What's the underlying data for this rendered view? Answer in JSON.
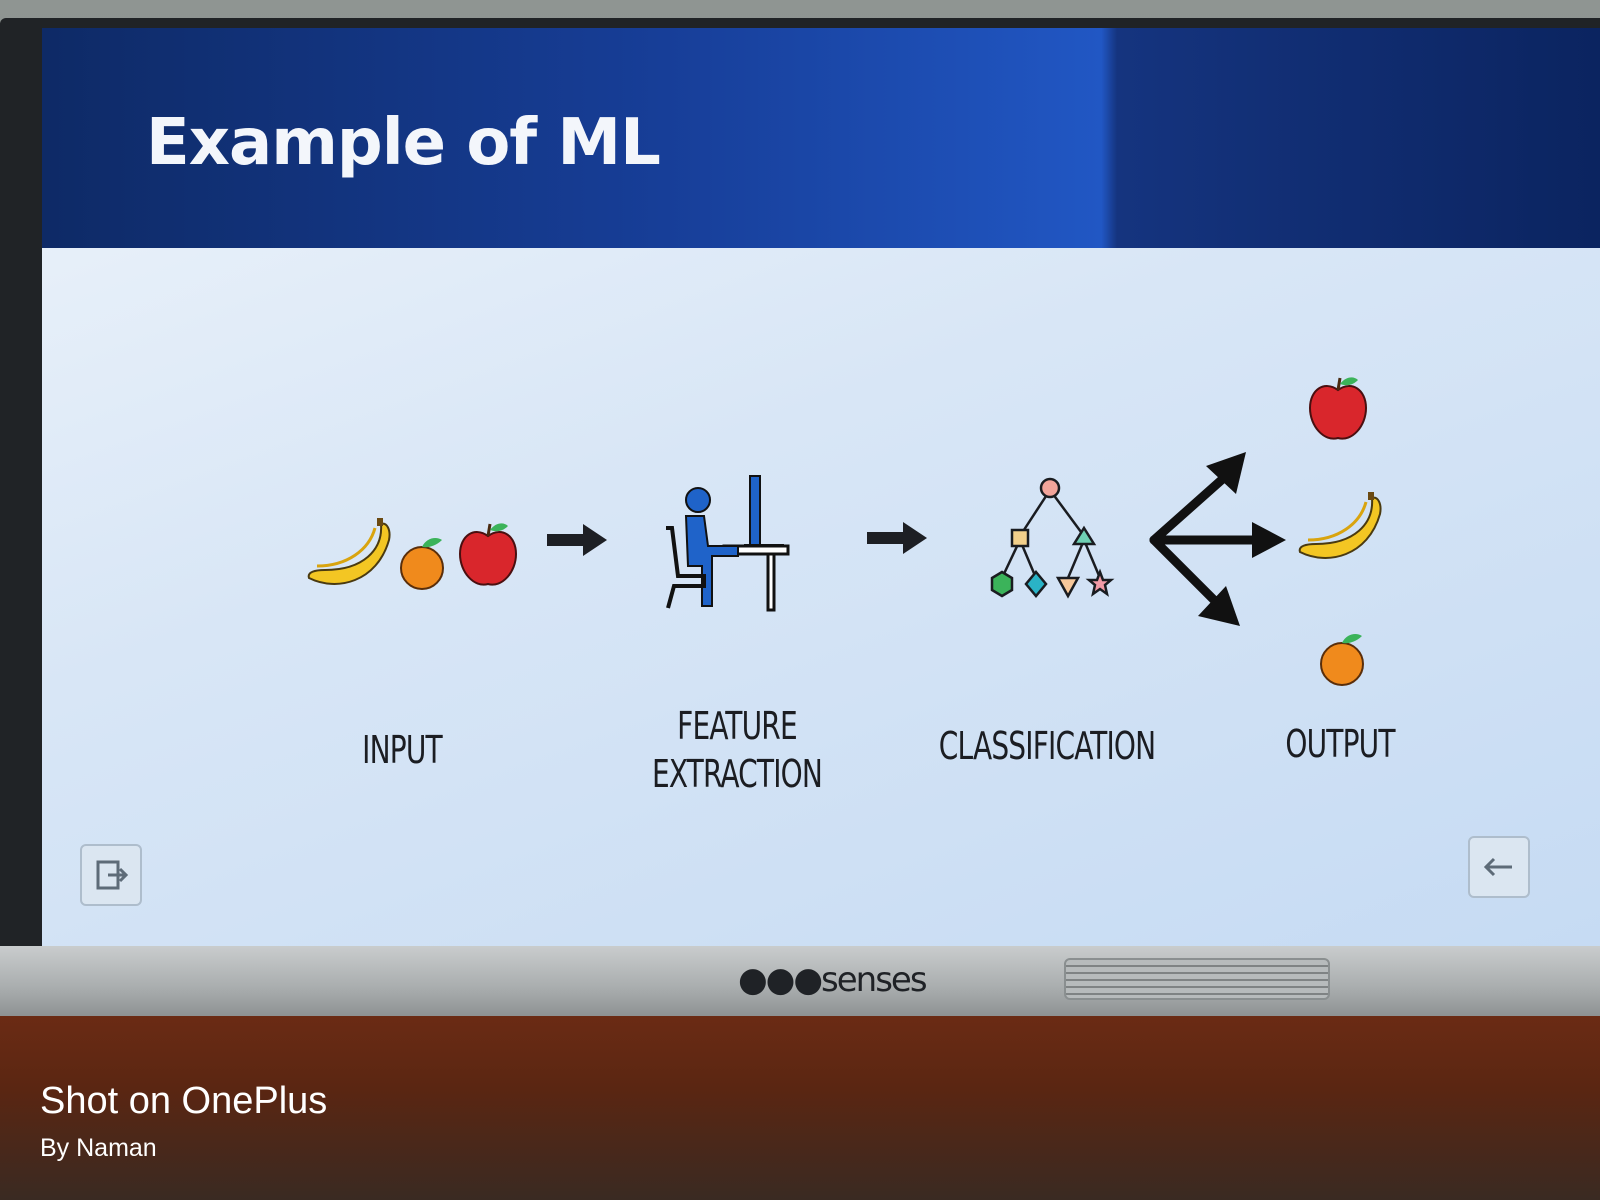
{
  "slide": {
    "title": "Example of ML",
    "stages": [
      {
        "id": "input",
        "label": "INPUT"
      },
      {
        "id": "feature-extraction",
        "label": "FEATURE\nEXTRACTION"
      },
      {
        "id": "classification",
        "label": "CLASSIFICATION"
      },
      {
        "id": "output",
        "label": "OUTPUT"
      }
    ],
    "input_items": [
      "banana-icon",
      "orange-icon",
      "apple-icon"
    ],
    "output_items": [
      "apple-icon",
      "banana-icon",
      "orange-icon"
    ]
  },
  "display": {
    "brand": "senses"
  },
  "watermark": {
    "main": "Shot on OnePlus",
    "sub": "By Naman"
  },
  "colors": {
    "header_blue": "#173e98",
    "banana": "#f3c623",
    "orange": "#f08a1c",
    "apple": "#d9262c",
    "worker_blue": "#1f63c9"
  }
}
